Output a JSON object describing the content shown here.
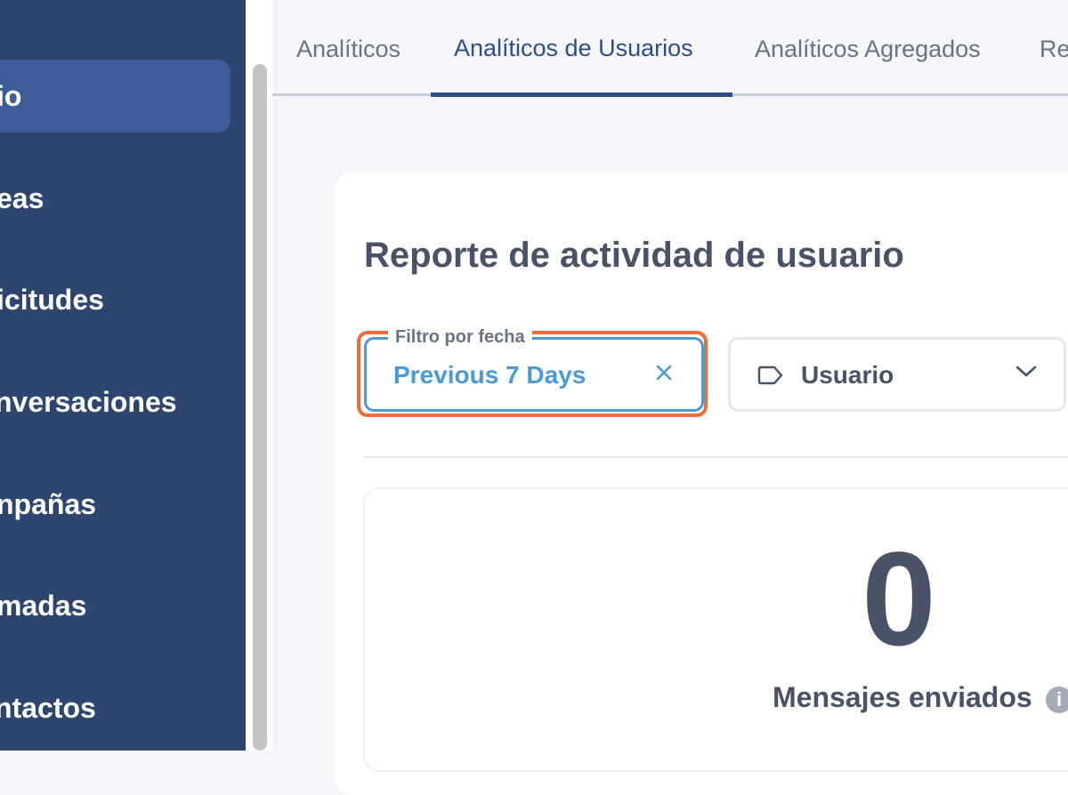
{
  "sidebar": {
    "items": [
      {
        "label": "io",
        "active": true
      },
      {
        "label": "eas"
      },
      {
        "label": "icitudes"
      },
      {
        "label": "nversaciones"
      },
      {
        "label": "npañas"
      },
      {
        "label": "madas"
      },
      {
        "label": "ntactos"
      }
    ]
  },
  "tabs": [
    {
      "label": "Analíticos"
    },
    {
      "label": "Analíticos de Usuarios",
      "active": true
    },
    {
      "label": "Analíticos Agregados"
    },
    {
      "label": "Re"
    }
  ],
  "report": {
    "title": "Reporte de actividad de usuario",
    "date_filter": {
      "label": "Filtro por fecha",
      "value": "Previous 7 Days",
      "clear_icon": "close-icon"
    },
    "user_filter": {
      "icon": "tag-icon",
      "label": "Usuario",
      "chevron": "chevron-down-icon"
    }
  },
  "stats": {
    "messages_sent": {
      "value": "0",
      "label": "Mensajes enviados",
      "info_icon": "i"
    }
  },
  "colors": {
    "sidebar_bg": "#2e4570",
    "sidebar_active": "#3d5d99",
    "accent": "#2d4f86",
    "filter_blue": "#4a9ad8",
    "highlight_orange": "#ef6d3c"
  }
}
